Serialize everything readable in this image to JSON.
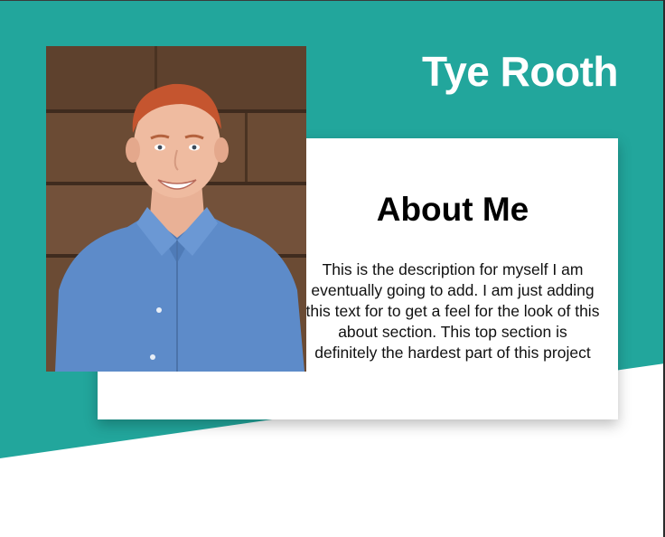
{
  "header": {
    "name": "Tye Rooth"
  },
  "about": {
    "heading": "About Me",
    "description": "This is the description for myself I am eventually going to add. I am just adding this text for to get a feel for the look of this about section. This top section is definitely the hardest part of this project"
  },
  "profile_photo": {
    "subject": "portrait-photo"
  },
  "colors": {
    "accent": "#22a69c",
    "card": "#ffffff",
    "text": "#000000",
    "shirt": "#5d8bc9",
    "wood": "#6a4a33"
  }
}
